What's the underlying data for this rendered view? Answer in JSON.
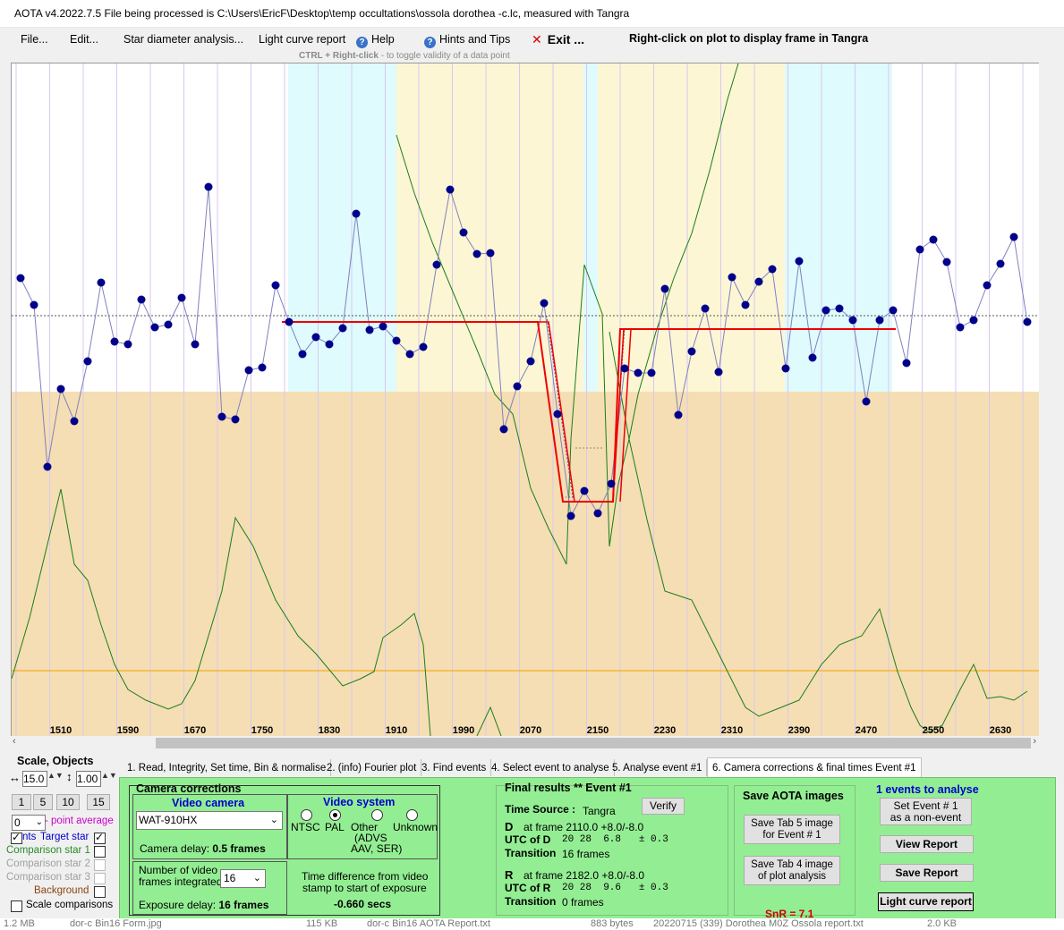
{
  "window": {
    "title": "AOTA v4.2022.7.5    File being processed is C:\\Users\\EricF\\Desktop\\temp occultations\\ossola dorothea -c.lc, measured with Tangra"
  },
  "menu": {
    "file": "File...",
    "edit": "Edit...",
    "star_diameter": "Star diameter analysis...",
    "light_curve_report": "Light curve report",
    "help": "Help",
    "hints": "Hints and Tips",
    "exit": "Exit ...",
    "right_click_hint": "Right-click on plot to display frame in Tangra",
    "ctrl_hint_bold": "CTRL + Right-click",
    "ctrl_hint_rest": "  -  to toggle validity of a data point"
  },
  "plot": {
    "x_tick_labels": [
      "1510",
      "1590",
      "1670",
      "1750",
      "1830",
      "1910",
      "1990",
      "2070",
      "2150",
      "2230",
      "2310",
      "2390",
      "2470",
      "2550",
      "2630"
    ],
    "colors": {
      "background_lower": "#f5deb3",
      "zone_cyan": "#dffbfd",
      "zone_yellow": "#fcf6d4",
      "data_points": "#00008b",
      "data_line": "#8080c0",
      "model_line": "#ee0000",
      "comparison_line": "#1b7d1b",
      "baseline_orange": "#f5a000",
      "gridline": "#d8c8f0"
    }
  },
  "left_panel": {
    "scale_objects": "Scale,  Objects",
    "scale_x": "15.0",
    "scale_y": "1.00",
    "btn_1": "1",
    "btn_5": "5",
    "btn_10": "10",
    "btn_15": "15",
    "point_avg_value": "0",
    "point_average": "- point average",
    "pts_label": "nts",
    "target_star": "Target star",
    "comparison_1": "Comparison star 1",
    "comparison_2": "Comparison star 2",
    "comparison_3": "Comparison star 3",
    "background": "Background",
    "scale_comparisons": "Scale comparisons"
  },
  "tabs": [
    "1.  Read, Integrity, Set time, Bin & normalise",
    "2. (info)  Fourier plot",
    "3. Find events",
    "4. Select event to analyse",
    "5. Analyse event #1",
    "6. Camera corrections & final times Event #1"
  ],
  "camera": {
    "section_title": "Camera corrections",
    "video_camera_title": "Video camera",
    "camera_model": "WAT-910HX",
    "camera_delay_label": "Camera delay: ",
    "camera_delay_value": "0.5 frames",
    "video_system_title": "Video system",
    "ntsc": "NTSC",
    "pal": "PAL",
    "other": "Other",
    "other_sub1": "(ADVS",
    "other_sub2": "AAV, SER)",
    "unknown": "Unknown",
    "frames_label_1": "Number of video",
    "frames_label_2": "frames integrated",
    "frames_value": "16",
    "exposure_delay_label": "Exposure delay: ",
    "exposure_delay_value": "16 frames",
    "time_diff_1": "Time difference from video",
    "time_diff_2": "stamp to start of exposure",
    "time_diff_value": "-0.660 secs"
  },
  "final": {
    "title": "Final results  **  Event #1",
    "verify": "Verify",
    "time_source_label": "Time Source :",
    "time_source_value": "Tangra",
    "d_label": "D",
    "d_frame": "at frame 2110.0  +8.0/-8.0",
    "utc_d_label": "UTC of D",
    "utc_d_value": "20 28  6.8   ± 0.3",
    "transition_label": "Transition",
    "transition_d": "16 frames",
    "r_label": "R",
    "r_frame": "at frame 2182.0  +8.0/-8.0",
    "utc_r_label": "UTC of R",
    "utc_r_value": "20 28  9.6   ± 0.3",
    "transition_r": "0 frames"
  },
  "save": {
    "title": "Save AOTA images",
    "tab5_1": "Save Tab 5 image",
    "tab5_2": "for Event # 1",
    "tab4_1": "Save Tab 4 image",
    "tab4_2": "of plot analysis",
    "snr": "SnR = 7.1"
  },
  "events": {
    "title": "1  events to analyse",
    "set_event_1": "Set Event # 1",
    "set_event_2": "as a non-event",
    "view_report": "View Report",
    "save_report": "Save Report",
    "light_curve_report": "Light curve report"
  },
  "status": {
    "size1": "1.2 MB",
    "file1": "dor-c Bin16 Form.jpg",
    "size2": "115 KB",
    "file2": "dor-c Bin16 AOTA Report.txt",
    "size3": "883 bytes",
    "file3": "20220715 (339) Dorothea M0Z Ossola report.txt",
    "size4": "2.0 KB"
  }
}
